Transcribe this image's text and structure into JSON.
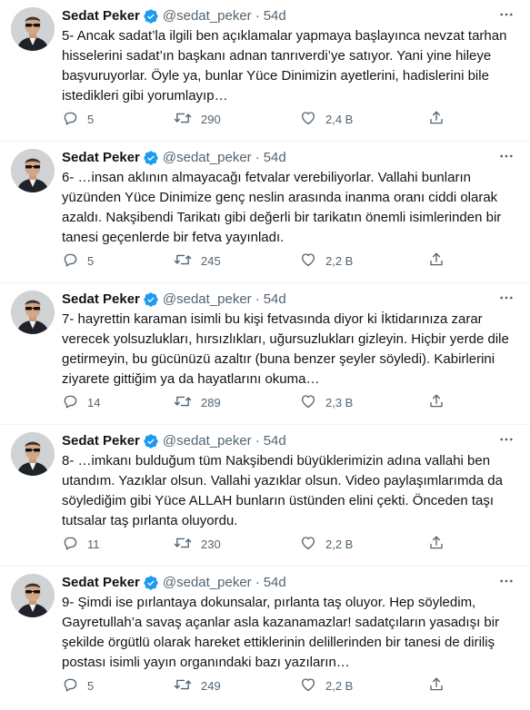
{
  "colors": {
    "text": "#0f1419",
    "secondary": "#536471",
    "verified": "#1d9bf0",
    "divider": "#eff3f4"
  },
  "icons": {
    "verified": "verified-badge-icon",
    "more": "more-options-icon",
    "reply": "reply-icon",
    "retweet": "retweet-icon",
    "like": "like-icon",
    "share": "share-icon"
  },
  "tweets": [
    {
      "name": "Sedat Peker",
      "handle": "@sedat_peker",
      "dot": "·",
      "time": "54d",
      "text": "5- Ancak sadat’la ilgili ben açıklamalar yapmaya başlayınca nevzat tarhan\nhisselerini sadat’ın başkanı adnan tanrıverdi’ye satıyor. Yani yine hileye\nbaşvuruyorlar. Öyle ya, bunlar Yüce Dinimizin ayetlerini, hadislerini bile\nistedikleri gibi yorumlayıp…",
      "replies": "5",
      "retweets": "290",
      "likes": "2,4 B"
    },
    {
      "name": "Sedat Peker",
      "handle": "@sedat_peker",
      "dot": "·",
      "time": "54d",
      "text": "6- …insan aklının almayacağı fetvalar verebiliyorlar. Vallahi bunların\nyüzünden Yüce Dinimize genç neslin arasında inanma oranı ciddi olarak\nazaldı. Nakşibendi Tarikatı gibi değerli bir tarikatın önemli isimlerinden bir\ntanesi geçenlerde bir fetva yayınladı.",
      "replies": "5",
      "retweets": "245",
      "likes": "2,2 B"
    },
    {
      "name": "Sedat Peker",
      "handle": "@sedat_peker",
      "dot": "·",
      "time": "54d",
      "text": "7- hayrettin karaman isimli bu kişi fetvasında diyor ki İktidarınıza zarar\nverecek yolsuzlukları, hırsızlıkları, uğursuzlukları gizleyin. Hiçbir yerde dile\ngetirmeyin, bu gücünüzü azaltır (buna benzer şeyler söyledi). Kabirlerini\nziyarete gittiğim ya da hayatlarını okuma…",
      "replies": "14",
      "retweets": "289",
      "likes": "2,3 B"
    },
    {
      "name": "Sedat Peker",
      "handle": "@sedat_peker",
      "dot": "·",
      "time": "54d",
      "text": "8- …imkanı bulduğum tüm Nakşibendi büyüklerimizin adına vallahi ben\nutandım. Yazıklar olsun. Vallahi yazıklar olsun. Video paylaşımlarımda da\nsöylediğim gibi Yüce ALLAH bunların üstünden elini çekti. Önceden taşı\ntutsalar taş pırlanta oluyordu.",
      "replies": "11",
      "retweets": "230",
      "likes": "2,2 B"
    },
    {
      "name": "Sedat Peker",
      "handle": "@sedat_peker",
      "dot": "·",
      "time": "54d",
      "text": "9- Şimdi ise pırlantaya dokunsalar, pırlanta taş oluyor. Hep söyledim,\nGayretullah’a savaş açanlar asla kazanamazlar! sadatçıların yasadışı bir\nşekilde örgütlü olarak hareket ettiklerinin delillerinden bir tanesi de diriliş\npostası isimli yayın organındaki bazı yazıların…",
      "replies": "5",
      "retweets": "249",
      "likes": "2,2 B"
    }
  ]
}
